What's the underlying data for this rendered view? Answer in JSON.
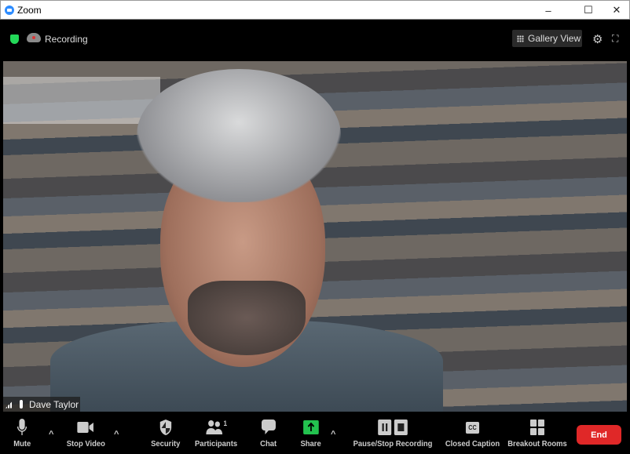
{
  "window": {
    "title": "Zoom",
    "minimize": "–",
    "maximize": "☐",
    "close": "✕"
  },
  "topbar": {
    "recording_label": "Recording",
    "gallery_view": "Gallery View"
  },
  "video": {
    "participant_name": "Dave Taylor"
  },
  "toolbar": {
    "mute": "Mute",
    "stop_video": "Stop Video",
    "security": "Security",
    "participants": "Participants",
    "participants_count": "1",
    "chat": "Chat",
    "share": "Share",
    "pause_stop_recording": "Pause/Stop Recording",
    "closed_caption": "Closed Caption",
    "cc_glyph": "CC",
    "breakout_rooms": "Breakout Rooms",
    "end": "End"
  },
  "colors": {
    "share": "#23c24f",
    "end": "#e02828",
    "shield": "#23d959",
    "accent": "#2d8cff"
  }
}
